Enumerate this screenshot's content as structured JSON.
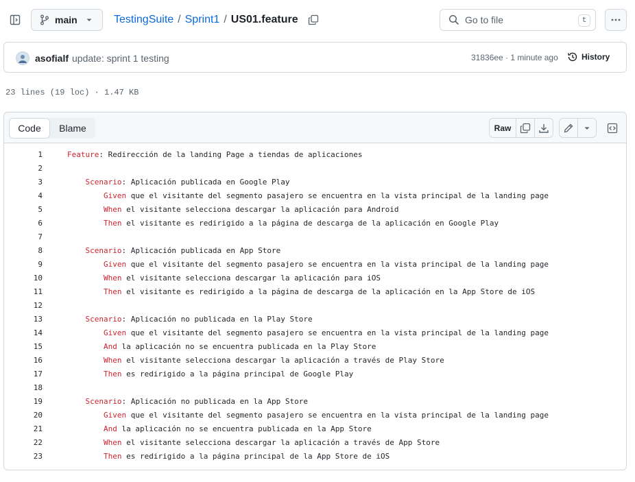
{
  "header": {
    "branch": "main",
    "breadcrumb": {
      "repo": "TestingSuite",
      "sep1": "/",
      "folder": "Sprint1",
      "sep2": "/",
      "file": "US01.feature"
    },
    "search_placeholder": "Go to file",
    "search_shortcut": "t",
    "icons": [
      "sidebar-toggle-icon",
      "git-branch-icon",
      "chevron-down-icon",
      "copy-icon",
      "search-icon",
      "kebab-icon"
    ]
  },
  "commit": {
    "author": "asofialf",
    "message": "update: sprint 1 testing",
    "meta": "31836ee · 1 minute ago",
    "history_label": "History"
  },
  "file_info": "23 lines (19 loc) · 1.47 KB",
  "toolbar": {
    "code_tab": "Code",
    "blame_tab": "Blame",
    "raw_label": "Raw"
  },
  "code": [
    {
      "n": "1",
      "indent": "",
      "kw": "Feature",
      "text": ": Redirección de la landing Page a tiendas de aplicaciones"
    },
    {
      "n": "2",
      "indent": "",
      "kw": "",
      "text": ""
    },
    {
      "n": "3",
      "indent": "    ",
      "kw": "Scenario",
      "text": ": Aplicación publicada en Google Play"
    },
    {
      "n": "4",
      "indent": "        ",
      "kw": "Given",
      "text": " que el visitante del segmento pasajero se encuentra en la vista principal de la landing page"
    },
    {
      "n": "5",
      "indent": "        ",
      "kw": "When",
      "text": " el visitante selecciona descargar la aplicación para Android"
    },
    {
      "n": "6",
      "indent": "        ",
      "kw": "Then",
      "text": " el visitante es redirigido a la página de descarga de la aplicación en Google Play"
    },
    {
      "n": "7",
      "indent": "",
      "kw": "",
      "text": ""
    },
    {
      "n": "8",
      "indent": "    ",
      "kw": "Scenario",
      "text": ": Aplicación publicada en App Store"
    },
    {
      "n": "9",
      "indent": "        ",
      "kw": "Given",
      "text": " que el visitante del segmento pasajero se encuentra en la vista principal de la landing page"
    },
    {
      "n": "10",
      "indent": "        ",
      "kw": "When",
      "text": " el visitante selecciona descargar la aplicación para iOS"
    },
    {
      "n": "11",
      "indent": "        ",
      "kw": "Then",
      "text": " el visitante es redirigido a la página de descarga de la aplicación en la App Store de iOS"
    },
    {
      "n": "12",
      "indent": "",
      "kw": "",
      "text": ""
    },
    {
      "n": "13",
      "indent": "    ",
      "kw": "Scenario",
      "text": ": Aplicación no publicada en la Play Store"
    },
    {
      "n": "14",
      "indent": "        ",
      "kw": "Given",
      "text": " que el visitante del segmento pasajero se encuentra en la vista principal de la landing page"
    },
    {
      "n": "15",
      "indent": "        ",
      "kw": "And",
      "text": " la aplicación no se encuentra publicada en la Play Store"
    },
    {
      "n": "16",
      "indent": "        ",
      "kw": "When",
      "text": " el visitante selecciona descargar la aplicación a través de Play Store"
    },
    {
      "n": "17",
      "indent": "        ",
      "kw": "Then",
      "text": " es redirigido a la página principal de Google Play"
    },
    {
      "n": "18",
      "indent": "",
      "kw": "",
      "text": ""
    },
    {
      "n": "19",
      "indent": "    ",
      "kw": "Scenario",
      "text": ": Aplicación no publicada en la App Store"
    },
    {
      "n": "20",
      "indent": "        ",
      "kw": "Given",
      "text": " que el visitante del segmento pasajero se encuentra en la vista principal de la landing page"
    },
    {
      "n": "21",
      "indent": "        ",
      "kw": "And",
      "text": " la aplicación no se encuentra publicada en la App Store"
    },
    {
      "n": "22",
      "indent": "        ",
      "kw": "When",
      "text": " el visitante selecciona descargar la aplicación a través de App Store"
    },
    {
      "n": "23",
      "indent": "        ",
      "kw": "Then",
      "text": " es redirigido a la página principal de la App Store de iOS"
    }
  ],
  "colors": {
    "link": "#0969da",
    "keyword": "#cf222e",
    "border": "#d1d9e0",
    "muted": "#59636e"
  }
}
